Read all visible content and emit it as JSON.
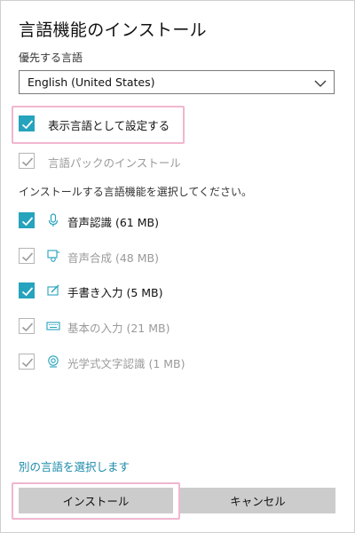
{
  "dialog": {
    "title": "言語機能のインストール",
    "preferred_language_label": "優先する言語",
    "language_dropdown": {
      "selected": "English (United States)"
    },
    "display_language": {
      "label": "表示言語として設定する",
      "checked": true
    },
    "language_pack": {
      "label": "言語パックのインストール",
      "checked": true,
      "disabled": true
    },
    "features_instruction": "インストールする言語機能を選択してください。",
    "features": [
      {
        "label": "音声認識 (61 MB)",
        "icon": "microphone-icon",
        "checked": true,
        "disabled": false
      },
      {
        "label": "音声合成 (48 MB)",
        "icon": "speech-synthesis-icon",
        "checked": true,
        "disabled": true
      },
      {
        "label": "手書き入力 (5 MB)",
        "icon": "handwriting-icon",
        "checked": true,
        "disabled": false
      },
      {
        "label": "基本の入力 (21 MB)",
        "icon": "keyboard-icon",
        "checked": true,
        "disabled": true
      },
      {
        "label": "光学式文字認識 (1 MB)",
        "icon": "ocr-icon",
        "checked": true,
        "disabled": true
      }
    ],
    "choose_other_link": "別の言語を選択します",
    "buttons": {
      "install": "インストール",
      "cancel": "キャンセル"
    },
    "colors": {
      "accent": "#26a3bd",
      "link": "#1a8aa8",
      "highlight": "#f0b6cf",
      "button_bg": "#cccccc"
    }
  }
}
